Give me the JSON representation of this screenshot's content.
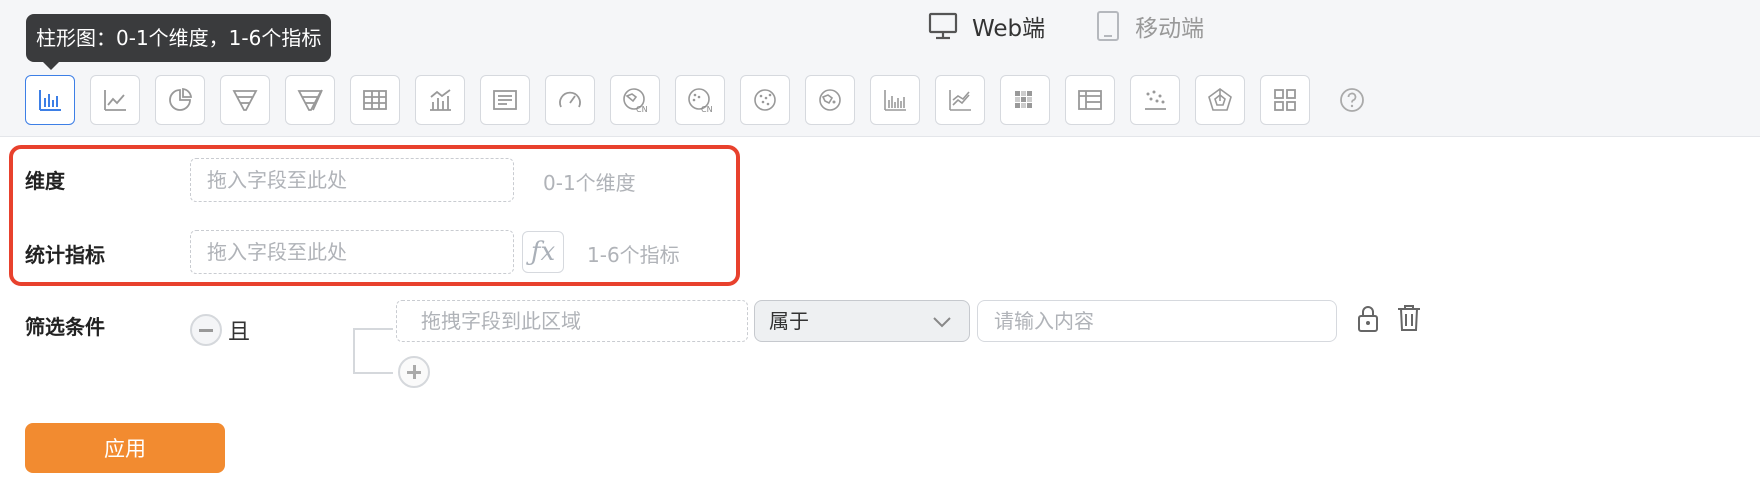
{
  "device_tabs": [
    {
      "label": "Web端",
      "icon": "monitor-icon",
      "active": true
    },
    {
      "label": "移动端",
      "icon": "mobile-icon",
      "active": false
    }
  ],
  "tooltip": {
    "text": "柱形图：0-1个维度，1-6个指标"
  },
  "chart_types": [
    {
      "name": "bar-chart-icon",
      "active": true
    },
    {
      "name": "line-chart-icon"
    },
    {
      "name": "pie-chart-icon"
    },
    {
      "name": "funnel-chart-icon"
    },
    {
      "name": "funnel-compare-icon"
    },
    {
      "name": "table-icon"
    },
    {
      "name": "bar-line-combo-icon"
    },
    {
      "name": "text-card-icon"
    },
    {
      "name": "gauge-icon"
    },
    {
      "name": "china-map-icon"
    },
    {
      "name": "china-scatter-map-icon"
    },
    {
      "name": "world-map-icon"
    },
    {
      "name": "world-scatter-map-icon"
    },
    {
      "name": "bar-multi-icon"
    },
    {
      "name": "line-multi-icon"
    },
    {
      "name": "heatmap-icon"
    },
    {
      "name": "pivot-table-icon"
    },
    {
      "name": "scatter-icon"
    },
    {
      "name": "radar-icon"
    },
    {
      "name": "grid-icon"
    }
  ],
  "dimension": {
    "label": "维度",
    "placeholder": "拖入字段至此处",
    "hint": "0-1个维度"
  },
  "metric": {
    "label": "统计指标",
    "placeholder": "拖入字段至此处",
    "fx": "ƒx",
    "hint": "1-6个指标"
  },
  "filter": {
    "label": "筛选条件",
    "logic": "且",
    "field_placeholder": "拖拽字段到此区域",
    "operator": "属于",
    "value_placeholder": "请输入内容"
  },
  "apply_label": "应用",
  "colors": {
    "accent": "#3d7fe6",
    "apply": "#f28b30",
    "highlight": "#e8412d"
  }
}
